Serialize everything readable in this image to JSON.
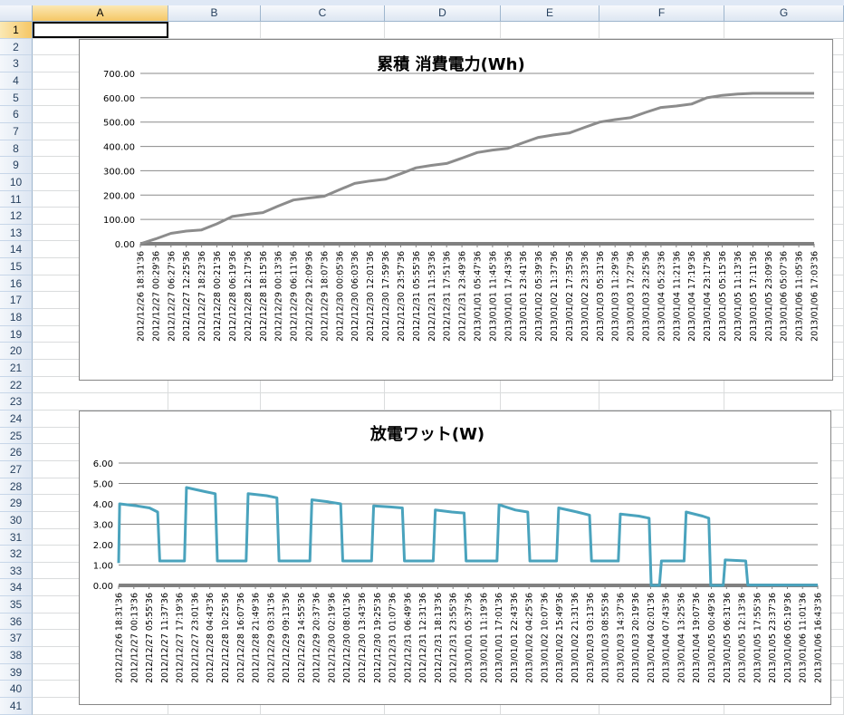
{
  "spreadsheet": {
    "columns": [
      "A",
      "B",
      "C",
      "D",
      "E",
      "F",
      "G"
    ],
    "rows": [
      "1",
      "2",
      "3",
      "4",
      "5",
      "6",
      "7",
      "8",
      "9",
      "10",
      "11",
      "12",
      "13",
      "14",
      "15",
      "16",
      "17",
      "18",
      "19",
      "20",
      "21",
      "22",
      "23",
      "24",
      "25",
      "26",
      "27",
      "28",
      "29",
      "30",
      "31",
      "32",
      "33",
      "34",
      "35",
      "36",
      "37",
      "38",
      "39",
      "40",
      "41"
    ],
    "active_cell": "A1"
  },
  "chart_data": [
    {
      "type": "line",
      "title": "累積 消費電力(Wh)",
      "ylim": [
        0,
        700
      ],
      "yticks": [
        "0.00",
        "100.00",
        "200.00",
        "300.00",
        "400.00",
        "500.00",
        "600.00",
        "700.00"
      ],
      "color": "#8c8c8c",
      "categories": [
        "2012/12/26 18:31'36",
        "2012/12/27 00:29'36",
        "2012/12/27 06:27'36",
        "2012/12/27 12:25'36",
        "2012/12/27 18:23'36",
        "2012/12/28 00:21'36",
        "2012/12/28 06:19'36",
        "2012/12/28 12:17'36",
        "2012/12/28 18:15'36",
        "2012/12/29 00:13'36",
        "2012/12/29 06:11'36",
        "2012/12/29 12:09'36",
        "2012/12/29 18:07'36",
        "2012/12/30 00:05'36",
        "2012/12/30 06:03'36",
        "2012/12/30 12:01'36",
        "2012/12/30 17:59'36",
        "2012/12/30 23:57'36",
        "2012/12/31 05:55'36",
        "2012/12/31 11:53'36",
        "2012/12/31 17:51'36",
        "2012/12/31 23:49'36",
        "2013/01/01 05:47'36",
        "2013/01/01 11:45'36",
        "2013/01/01 17:43'36",
        "2013/01/01 23:41'36",
        "2013/01/02 05:39'36",
        "2013/01/02 11:37'36",
        "2013/01/02 17:35'36",
        "2013/01/02 23:33'36",
        "2013/01/03 05:31'36",
        "2013/01/03 11:29'36",
        "2013/01/03 17:27'36",
        "2013/01/03 23:25'36",
        "2013/01/04 05:23'36",
        "2013/01/04 11:21'36",
        "2013/01/04 17:19'36",
        "2013/01/04 23:17'36",
        "2013/01/05 05:15'36",
        "2013/01/05 11:13'36",
        "2013/01/05 17:11'36",
        "2013/01/05 23:09'36",
        "2013/01/06 05:07'36",
        "2013/01/06 11:05'36",
        "2013/01/06 17:03'36"
      ],
      "values": [
        0,
        20,
        43,
        52,
        57,
        82,
        112,
        121,
        128,
        155,
        180,
        188,
        195,
        222,
        248,
        258,
        265,
        288,
        312,
        322,
        330,
        352,
        375,
        385,
        392,
        415,
        437,
        447,
        455,
        478,
        500,
        510,
        518,
        540,
        560,
        566,
        574,
        600,
        610,
        615,
        618,
        618,
        618,
        618,
        618
      ]
    },
    {
      "type": "line",
      "title": "放電ワット(W)",
      "ylim": [
        0,
        6
      ],
      "yticks": [
        "0.00",
        "1.00",
        "2.00",
        "3.00",
        "4.00",
        "5.00",
        "6.00"
      ],
      "color": "#4aa3bd",
      "categories": [
        "2012/12/26 18:31'36",
        "2012/12/27 00:13'36",
        "2012/12/27 05:55'36",
        "2012/12/27 11:37'36",
        "2012/12/27 17:19'36",
        "2012/12/27 23:01'36",
        "2012/12/28 04:43'36",
        "2012/12/28 10:25'36",
        "2012/12/28 16:07'36",
        "2012/12/28 21:49'36",
        "2012/12/29 03:31'36",
        "2012/12/29 09:13'36",
        "2012/12/29 14:55'36",
        "2012/12/29 20:37'36",
        "2012/12/30 02:19'36",
        "2012/12/30 08:01'36",
        "2012/12/30 13:43'36",
        "2012/12/30 19:25'36",
        "2012/12/31 01:07'36",
        "2012/12/31 06:49'36",
        "2012/12/31 12:31'36",
        "2012/12/31 18:13'36",
        "2012/12/31 23:55'36",
        "2013/01/01 05:37'36",
        "2013/01/01 11:19'36",
        "2013/01/01 17:01'36",
        "2013/01/01 22:43'36",
        "2013/01/02 04:25'36",
        "2013/01/02 10:07'36",
        "2013/01/02 15:49'36",
        "2013/01/02 21:31'36",
        "2013/01/03 03:13'36",
        "2013/01/03 08:55'36",
        "2013/01/03 14:37'36",
        "2013/01/03 20:19'36",
        "2013/01/04 02:01'36",
        "2013/01/04 07:43'36",
        "2013/01/04 13:25'36",
        "2013/01/04 19:07'36",
        "2013/01/05 00:49'36",
        "2013/01/05 06:31'36",
        "2013/01/05 12:13'36",
        "2013/01/05 17:55'36",
        "2013/01/05 23:37'36",
        "2013/01/06 05:19'36",
        "2013/01/06 11:01'36",
        "2013/01/06 16:43'36"
      ],
      "points": [
        [
          0,
          1.1
        ],
        [
          0.05,
          4.0
        ],
        [
          0.9,
          3.9
        ],
        [
          1.5,
          3.8
        ],
        [
          1.9,
          3.6
        ],
        [
          2.0,
          1.2
        ],
        [
          3.2,
          1.2
        ],
        [
          3.3,
          4.8
        ],
        [
          4.2,
          4.6
        ],
        [
          4.7,
          4.5
        ],
        [
          4.8,
          1.2
        ],
        [
          6.2,
          1.2
        ],
        [
          6.3,
          4.5
        ],
        [
          7.2,
          4.4
        ],
        [
          7.7,
          4.3
        ],
        [
          7.8,
          1.2
        ],
        [
          9.3,
          1.2
        ],
        [
          9.4,
          4.2
        ],
        [
          10.2,
          4.1
        ],
        [
          10.8,
          4.0
        ],
        [
          10.9,
          1.2
        ],
        [
          12.3,
          1.2
        ],
        [
          12.4,
          3.9
        ],
        [
          13.2,
          3.85
        ],
        [
          13.8,
          3.8
        ],
        [
          13.9,
          1.2
        ],
        [
          15.3,
          1.2
        ],
        [
          15.4,
          3.7
        ],
        [
          16.2,
          3.6
        ],
        [
          16.8,
          3.55
        ],
        [
          16.9,
          1.2
        ],
        [
          18.4,
          1.2
        ],
        [
          18.5,
          3.95
        ],
        [
          19.3,
          3.7
        ],
        [
          19.9,
          3.6
        ],
        [
          20.0,
          1.2
        ],
        [
          21.3,
          1.2
        ],
        [
          21.4,
          3.8
        ],
        [
          22.3,
          3.6
        ],
        [
          22.9,
          3.45
        ],
        [
          23.0,
          1.2
        ],
        [
          24.3,
          1.2
        ],
        [
          24.4,
          3.5
        ],
        [
          25.3,
          3.4
        ],
        [
          25.8,
          3.3
        ],
        [
          25.9,
          0.0
        ],
        [
          26.3,
          0.0
        ],
        [
          26.4,
          1.2
        ],
        [
          27.5,
          1.2
        ],
        [
          27.6,
          3.6
        ],
        [
          28.4,
          3.4
        ],
        [
          28.7,
          3.3
        ],
        [
          28.8,
          0.0
        ],
        [
          29.4,
          0.0
        ],
        [
          29.5,
          1.25
        ],
        [
          30.5,
          1.2
        ],
        [
          30.6,
          0.02
        ],
        [
          32.0,
          0.02
        ],
        [
          34.0,
          0.02
        ]
      ]
    }
  ]
}
